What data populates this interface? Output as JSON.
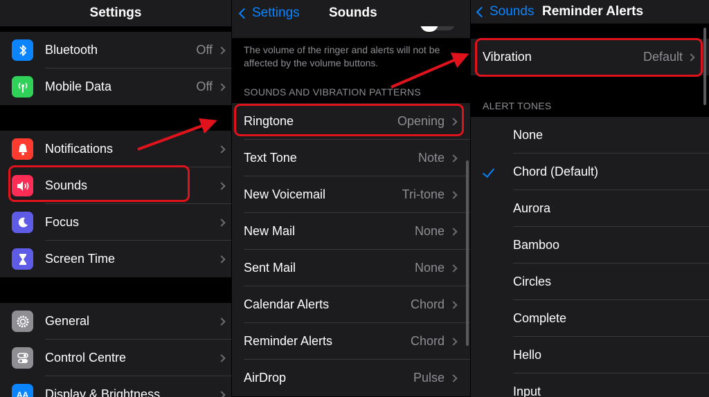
{
  "panel1": {
    "title": "Settings",
    "items": [
      {
        "label": "Bluetooth",
        "value": "Off"
      },
      {
        "label": "Mobile Data",
        "value": "Off"
      },
      {
        "label": "Notifications",
        "value": ""
      },
      {
        "label": "Sounds",
        "value": ""
      },
      {
        "label": "Focus",
        "value": ""
      },
      {
        "label": "Screen Time",
        "value": ""
      },
      {
        "label": "General",
        "value": ""
      },
      {
        "label": "Control Centre",
        "value": ""
      },
      {
        "label": "Display & Brightness",
        "value": ""
      }
    ],
    "icon_badge": "AA"
  },
  "panel2": {
    "back_label": "Settings",
    "title": "Sounds",
    "footer_text_line1": "The volume of the ringer and alerts will not be",
    "footer_text_line2": "affected by the volume buttons.",
    "section_header": "SOUNDS AND VIBRATION PATTERNS",
    "items": [
      {
        "label": "Ringtone",
        "value": "Opening"
      },
      {
        "label": "Text Tone",
        "value": "Note"
      },
      {
        "label": "New Voicemail",
        "value": "Tri-tone"
      },
      {
        "label": "New Mail",
        "value": "None"
      },
      {
        "label": "Sent Mail",
        "value": "None"
      },
      {
        "label": "Calendar Alerts",
        "value": "Chord"
      },
      {
        "label": "Reminder Alerts",
        "value": "Chord"
      },
      {
        "label": "AirDrop",
        "value": "Pulse"
      }
    ]
  },
  "panel3": {
    "back_label": "Sounds",
    "title": "Reminder Alerts",
    "vibration": {
      "label": "Vibration",
      "value": "Default"
    },
    "section_header": "ALERT TONES",
    "tones": [
      "None",
      "Chord (Default)",
      "Aurora",
      "Bamboo",
      "Circles",
      "Complete",
      "Hello",
      "Input"
    ],
    "selected_tone": "Chord (Default)"
  },
  "colors": {
    "accent": "#0a84ff",
    "highlight": "#e0131d",
    "bluetooth": "#0a84ff",
    "mobile_data": "#30d158",
    "notifications": "#ff3b30",
    "sounds": "#ff2d55",
    "focus": "#5e5ce6",
    "screen_time": "#5e5ce6",
    "general": "#8e8e93",
    "control_centre": "#8e8e93",
    "display": "#0a84ff"
  },
  "icons": {
    "bluetooth": "bluetooth-icon",
    "mobile_data": "antenna-icon",
    "notifications": "bell-icon",
    "sounds": "speaker-icon",
    "focus": "moon-icon",
    "screen_time": "hourglass-icon",
    "general": "gear-icon",
    "control_centre": "toggles-icon",
    "display": "text-size-icon"
  }
}
